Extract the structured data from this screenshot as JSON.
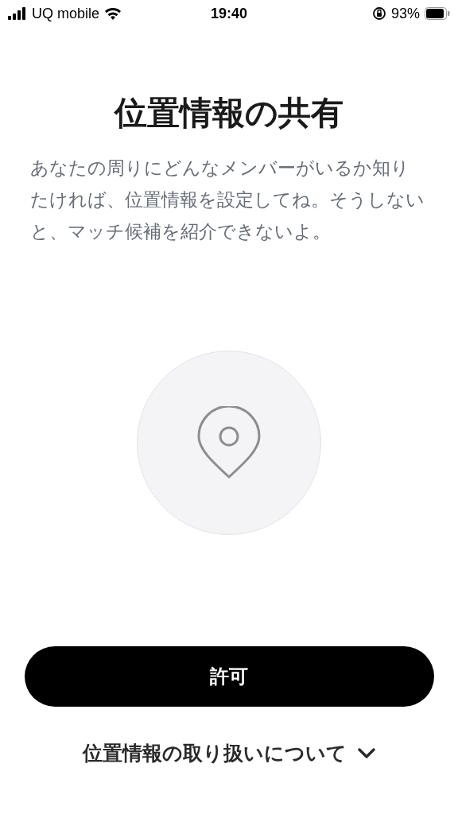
{
  "status_bar": {
    "carrier": "UQ mobile",
    "time": "19:40",
    "battery": "93%"
  },
  "title": "位置情報の共有",
  "description": "あなたの周りにどんなメンバーがいるか知りたければ、位置情報を設定してね。そうしないと、マッチ候補を紹介できないよ。",
  "allow_button": "許可",
  "info_link": "位置情報の取り扱いについて"
}
